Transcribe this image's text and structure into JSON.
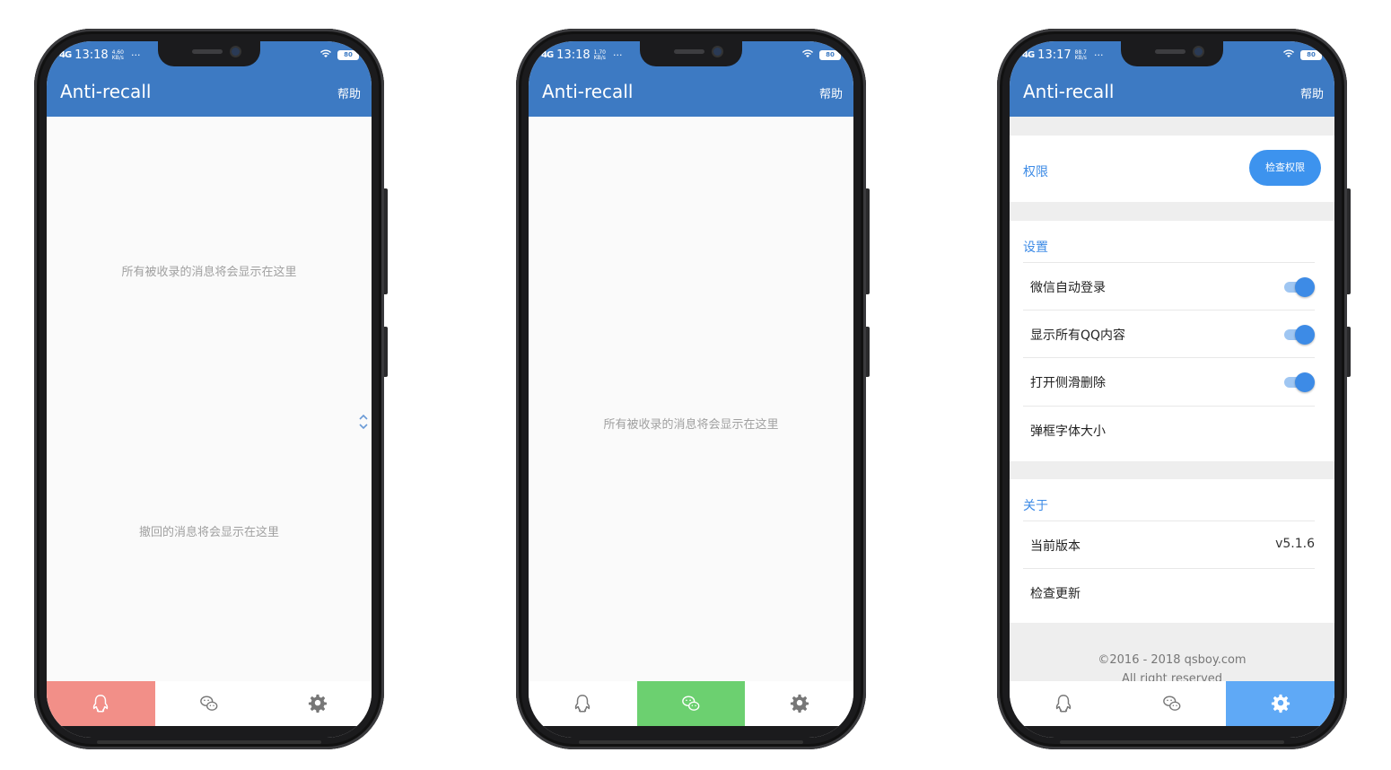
{
  "phones": [
    {
      "status": {
        "signal": "4G",
        "time": "13:18",
        "speed": "4.60",
        "speed_unit": "KB/s",
        "more": "···",
        "battery": "80"
      },
      "app_title": "Anti-recall",
      "help_label": "帮助",
      "hints": [
        "所有被收录的消息将会显示在这里",
        "撤回的消息将会显示在这里"
      ],
      "active_tab": "qq"
    },
    {
      "status": {
        "signal": "4G",
        "time": "13:18",
        "speed": "1.70",
        "speed_unit": "KB/s",
        "more": "···",
        "battery": "80"
      },
      "app_title": "Anti-recall",
      "help_label": "帮助",
      "hints": [
        "所有被收录的消息将会显示在这里"
      ],
      "active_tab": "wechat"
    },
    {
      "status": {
        "signal": "4G",
        "time": "13:17",
        "speed": "88.7",
        "speed_unit": "KB/s",
        "more": "···",
        "battery": "80"
      },
      "app_title": "Anti-recall",
      "help_label": "帮助",
      "active_tab": "settings",
      "permission": {
        "label": "权限",
        "button": "检查权限"
      },
      "settings_section": {
        "title": "设置",
        "items": [
          {
            "label": "微信自动登录",
            "toggle": true
          },
          {
            "label": "显示所有QQ内容",
            "toggle": true
          },
          {
            "label": "打开侧滑删除",
            "toggle": true
          },
          {
            "label": "弹框字体大小"
          }
        ]
      },
      "about_section": {
        "title": "关于",
        "items": [
          {
            "label": "当前版本",
            "value": "v5.1.6"
          },
          {
            "label": "检查更新"
          }
        ]
      },
      "footer": {
        "copyright": "©2016 - 2018 qsboy.com",
        "rights": "All right reserved"
      }
    }
  ],
  "tabs": [
    {
      "name": "qq",
      "icon": "qq-penguin-icon"
    },
    {
      "name": "wechat",
      "icon": "wechat-chat-icon"
    },
    {
      "name": "settings",
      "icon": "gear-icon"
    }
  ],
  "colors": {
    "primary": "#3d7ac3",
    "accent_blue": "#3d8be6",
    "qq_tab_active": "#f28f88",
    "wechat_tab_active": "#6cd070",
    "settings_tab_active": "#5fa9f6"
  }
}
